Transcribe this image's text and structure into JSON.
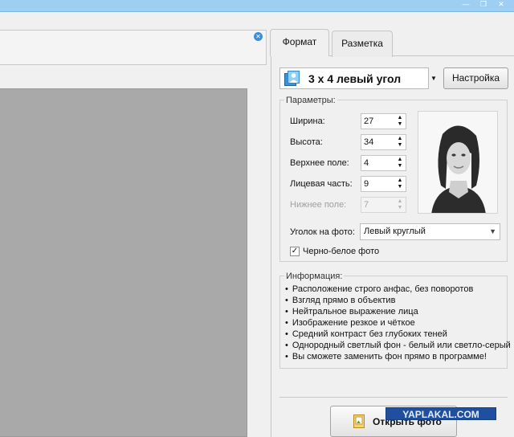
{
  "window": {
    "minimize_glyph": "—",
    "restore_glyph": "❐",
    "close_glyph": "✕"
  },
  "left": {
    "close_badge_glyph": "✕"
  },
  "tabs": [
    {
      "label": "Формат",
      "active": true
    },
    {
      "label": "Разметка",
      "active": false
    }
  ],
  "format": {
    "selected": "3 х 4 левый угол",
    "dropdown_glyph": "▼",
    "settings_button": "Настройка"
  },
  "parameters": {
    "legend": "Параметры:",
    "fields": [
      {
        "label": "Ширина:",
        "value": "27",
        "enabled": true
      },
      {
        "label": "Высота:",
        "value": "34",
        "enabled": true
      },
      {
        "label": "Верхнее поле:",
        "value": "4",
        "enabled": true
      },
      {
        "label": "Лицевая часть:",
        "value": "9",
        "enabled": true
      },
      {
        "label": "Нижнее поле:",
        "value": "7",
        "enabled": false
      }
    ],
    "spin_up_glyph": "▲",
    "spin_down_glyph": "▼",
    "corner_label": "Уголок на фото:",
    "corner_value": "Левый круглый",
    "corner_arrow_glyph": "▼",
    "bw_label": "Черно-белое фото",
    "bw_checked": true,
    "check_glyph": "✓"
  },
  "info": {
    "legend": "Информация:",
    "items": [
      "Расположение строго анфас, без поворотов",
      "Взгляд прямо в объектив",
      "Нейтральное выражение лица",
      "Изображение резкое и чёткое",
      "Средний контраст без глубоких теней",
      "Однородный светлый фон - белый или светло-серый",
      "Вы сможете заменить фон прямо в программе!"
    ]
  },
  "actions": {
    "open_photo": "Открыть фото"
  },
  "watermark": {
    "text": "YAPLAKAL.COM"
  },
  "icons": {
    "format": "photo-id-card-icon",
    "open": "open-photo-icon"
  },
  "colors": {
    "titlebar": "#9ecff2",
    "canvas": "#a9a9a9",
    "accent": "#3c8fd6"
  }
}
